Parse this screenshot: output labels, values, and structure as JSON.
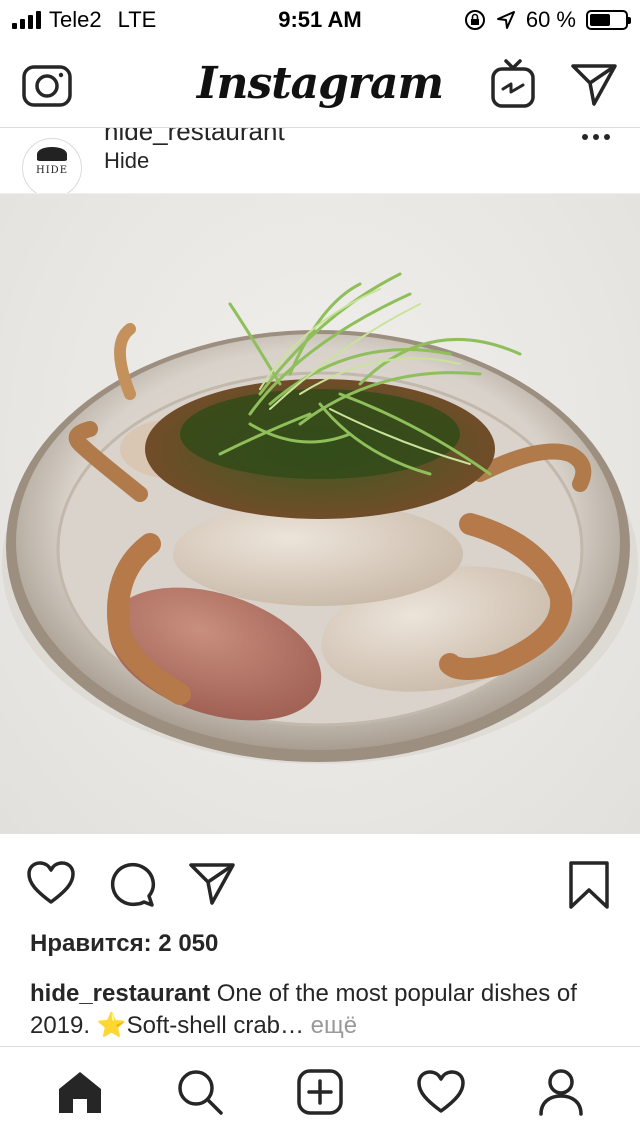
{
  "status_bar": {
    "carrier": "Tele2",
    "network": "LTE",
    "time": "9:51 AM",
    "battery": "60 %",
    "battery_level": 0.6
  },
  "header": {
    "logo": "Instagram",
    "icons": [
      "camera-icon",
      "igtv-icon",
      "direct-message-icon"
    ]
  },
  "post": {
    "username": "hide_restaurant",
    "avatar_text": "HIDE",
    "location": "Hide",
    "likes": "Нравится: 2 050",
    "caption_user": "hide_restaurant",
    "caption_text": " One of the most popular dishes of 2019. ⭐Soft-shell crab…",
    "caption_more": " ещё"
  },
  "colors": {
    "text": "#262626",
    "muted": "#999999",
    "border": "#dbdbdb"
  },
  "bottom_nav": [
    "home-icon",
    "search-icon",
    "add-post-icon",
    "activity-icon",
    "profile-icon"
  ]
}
